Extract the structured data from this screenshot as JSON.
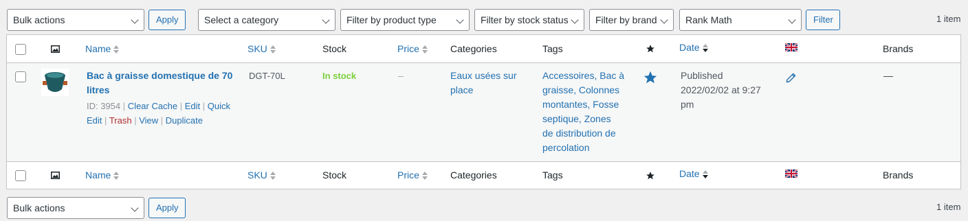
{
  "top_bar": {
    "bulk_actions": "Bulk actions",
    "apply": "Apply",
    "category_filter": "Select a category",
    "product_type_filter": "Filter by product type",
    "stock_status_filter": "Filter by stock status",
    "brand_filter": "Filter by brand",
    "seo_filter": "Rank Math",
    "filter_button": "Filter",
    "item_count": "1 item"
  },
  "columns": {
    "name": "Name",
    "sku": "SKU",
    "stock": "Stock",
    "price": "Price",
    "categories": "Categories",
    "tags": "Tags",
    "date": "Date",
    "brands": "Brands"
  },
  "product": {
    "name_line1": "Bac à graisse domestique de 70",
    "name_line2": "litres",
    "id_label": "ID: 3954",
    "actions": {
      "clear_cache": "Clear Cache",
      "edit": "Edit",
      "quick": "Quick",
      "quick_edit_rest": "Edit",
      "trash": "Trash",
      "view": "View",
      "duplicate": "Duplicate"
    },
    "sku": "DGT-70L",
    "stock": "In stock",
    "price": "–",
    "category_line1": "Eaux usées sur",
    "category_line2": "place",
    "tags_lines": [
      "Accessoires, Bac à",
      "graisse, Colonnes",
      "montantes, Fosse",
      "septique, Zones",
      "de distribution de",
      "percolation"
    ],
    "status": "Published",
    "date_line1": "2022/02/02 at 9:27",
    "date_line2": "pm",
    "brand": "—",
    "featured": true
  },
  "bottom_bar": {
    "bulk_actions": "Bulk actions",
    "apply": "Apply",
    "item_count": "1 item"
  },
  "colors": {
    "accent": "#2271b1",
    "in_stock": "#7ad03a",
    "trash": "#b32d2e",
    "row_bg": "#f6f7f7"
  }
}
